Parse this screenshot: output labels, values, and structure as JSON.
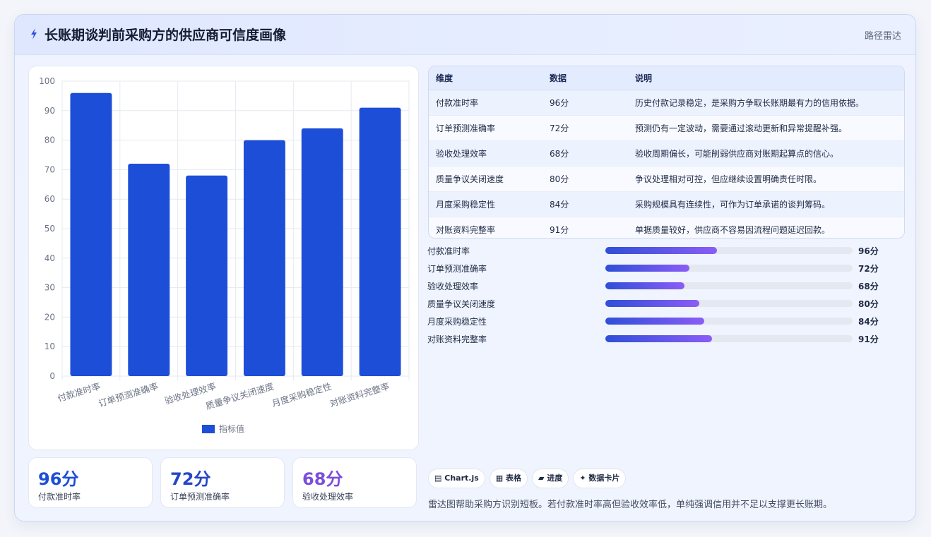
{
  "header": {
    "title": "长账期谈判前采购方的供应商可信度画像",
    "tag": "路径雷达",
    "icon": "lightning-icon"
  },
  "chart_data": {
    "type": "bar",
    "categories": [
      "付款准时率",
      "订单预测准确率",
      "验收处理效率",
      "质量争议关闭速度",
      "月度采购稳定性",
      "对账资料完整率"
    ],
    "series": [
      {
        "name": "指标值",
        "values": [
          96,
          72,
          68,
          80,
          84,
          91
        ],
        "color": "#1d4ed8"
      }
    ],
    "ylim": [
      0,
      100
    ],
    "yticks": [
      0,
      10,
      20,
      30,
      40,
      50,
      60,
      70,
      80,
      90,
      100
    ],
    "grid": true,
    "legend": "bottom"
  },
  "stats": [
    {
      "value": "96分",
      "label": "付款准时率",
      "color": "#1d4ed8"
    },
    {
      "value": "72分",
      "label": "订单预测准确率",
      "color": "#2546c8"
    },
    {
      "value": "68分",
      "label": "验收处理效率",
      "color": "#7c4ddc"
    }
  ],
  "table": {
    "headers": [
      "维度",
      "数据",
      "说明"
    ],
    "rows": [
      [
        "付款准时率",
        "96分",
        "历史付款记录稳定，是采购方争取长账期最有力的信用依据。"
      ],
      [
        "订单预测准确率",
        "72分",
        "预测仍有一定波动，需要通过滚动更新和异常提醒补强。"
      ],
      [
        "验收处理效率",
        "68分",
        "验收周期偏长，可能削弱供应商对账期起算点的信心。"
      ],
      [
        "质量争议关闭速度",
        "80分",
        "争议处理相对可控，但应继续设置明确责任时限。"
      ],
      [
        "月度采购稳定性",
        "84分",
        "采购规模具有连续性，可作为订单承诺的谈判筹码。"
      ],
      [
        "对账资料完整率",
        "91分",
        "单据质量较好，供应商不容易因流程问题延迟回款。"
      ]
    ]
  },
  "progress": [
    {
      "label": "付款准时率",
      "value": "96分",
      "fraction": 0.45
    },
    {
      "label": "订单预测准确率",
      "value": "72分",
      "fraction": 0.34
    },
    {
      "label": "验收处理效率",
      "value": "68分",
      "fraction": 0.32
    },
    {
      "label": "质量争议关闭速度",
      "value": "80分",
      "fraction": 0.38
    },
    {
      "label": "月度采购稳定性",
      "value": "84分",
      "fraction": 0.4
    },
    {
      "label": "对账资料完整率",
      "value": "91分",
      "fraction": 0.43
    }
  ],
  "chips": [
    {
      "icon": "chart-icon",
      "glyph": "▤",
      "label": "Chart.js"
    },
    {
      "icon": "table-icon",
      "glyph": "▦",
      "label": "表格"
    },
    {
      "icon": "progress-icon",
      "glyph": "▰",
      "label": "进度"
    },
    {
      "icon": "sparkle-icon",
      "glyph": "✦",
      "label": "数据卡片"
    }
  ],
  "note": "雷达图帮助采购方识别短板。若付款准时率高但验收效率低，单纯强调信用并不足以支撑更长账期。"
}
